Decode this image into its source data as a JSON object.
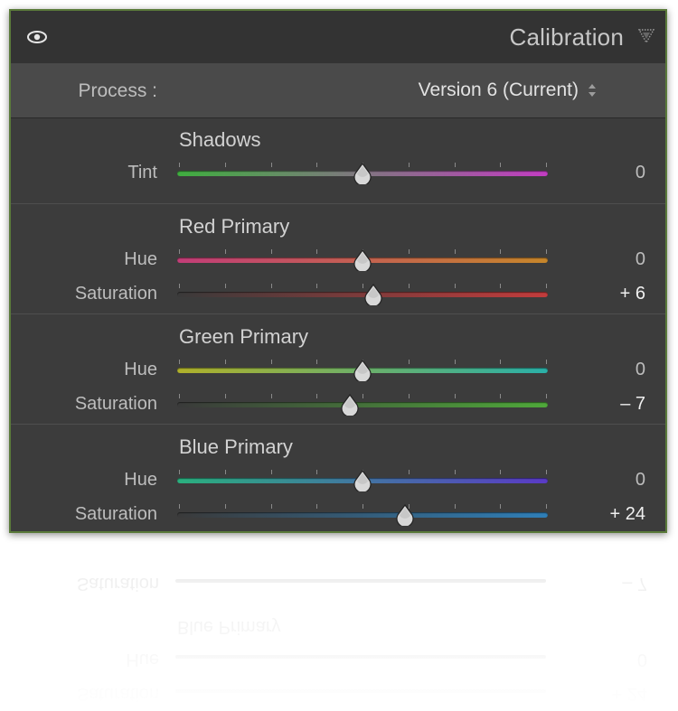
{
  "panel": {
    "title": "Calibration",
    "process_label": "Process :",
    "process_value": "Version 6 (Current)"
  },
  "colors": {
    "panel_border": "#5a7a3a",
    "panel_bg": "#3c3c3c",
    "header_bg": "#333333",
    "process_bg": "#4a4a4a"
  },
  "icons": {
    "visibility": "eye-icon",
    "collapse": "triangle-down-icon",
    "process_select": "updown-arrows-icon"
  },
  "sections": [
    {
      "title": "Shadows",
      "sliders": [
        {
          "label": "Tint",
          "value_text": "0",
          "value": 0,
          "min": -100,
          "max": 100,
          "gradient": [
            "#3fae3f",
            "#c23dc2"
          ]
        }
      ]
    },
    {
      "title": "Red Primary",
      "sliders": [
        {
          "label": "Hue",
          "value_text": "0",
          "value": 0,
          "min": -100,
          "max": 100,
          "gradient": [
            "#c23d78",
            "#c6862a"
          ]
        },
        {
          "label": "Saturation",
          "value_text": "+ 6",
          "value": 6,
          "min": -100,
          "max": 100,
          "gradient": [
            "#3a3a3a",
            "#c23c3c"
          ]
        }
      ]
    },
    {
      "title": "Green Primary",
      "sliders": [
        {
          "label": "Hue",
          "value_text": "0",
          "value": 0,
          "min": -100,
          "max": 100,
          "gradient": [
            "#b0b02a",
            "#2ab0a8"
          ]
        },
        {
          "label": "Saturation",
          "value_text": "– 7",
          "value": -7,
          "min": -100,
          "max": 100,
          "gradient": [
            "#3a3a3a",
            "#4fa83a"
          ]
        }
      ]
    },
    {
      "title": "Blue Primary",
      "sliders": [
        {
          "label": "Hue",
          "value_text": "0",
          "value": 0,
          "min": -100,
          "max": 100,
          "gradient": [
            "#2ab07e",
            "#5a3ac6"
          ]
        },
        {
          "label": "Saturation",
          "value_text": "+ 24",
          "value": 24,
          "min": -100,
          "max": 100,
          "gradient": [
            "#3a3a3a",
            "#2f7fb8"
          ]
        }
      ]
    }
  ]
}
